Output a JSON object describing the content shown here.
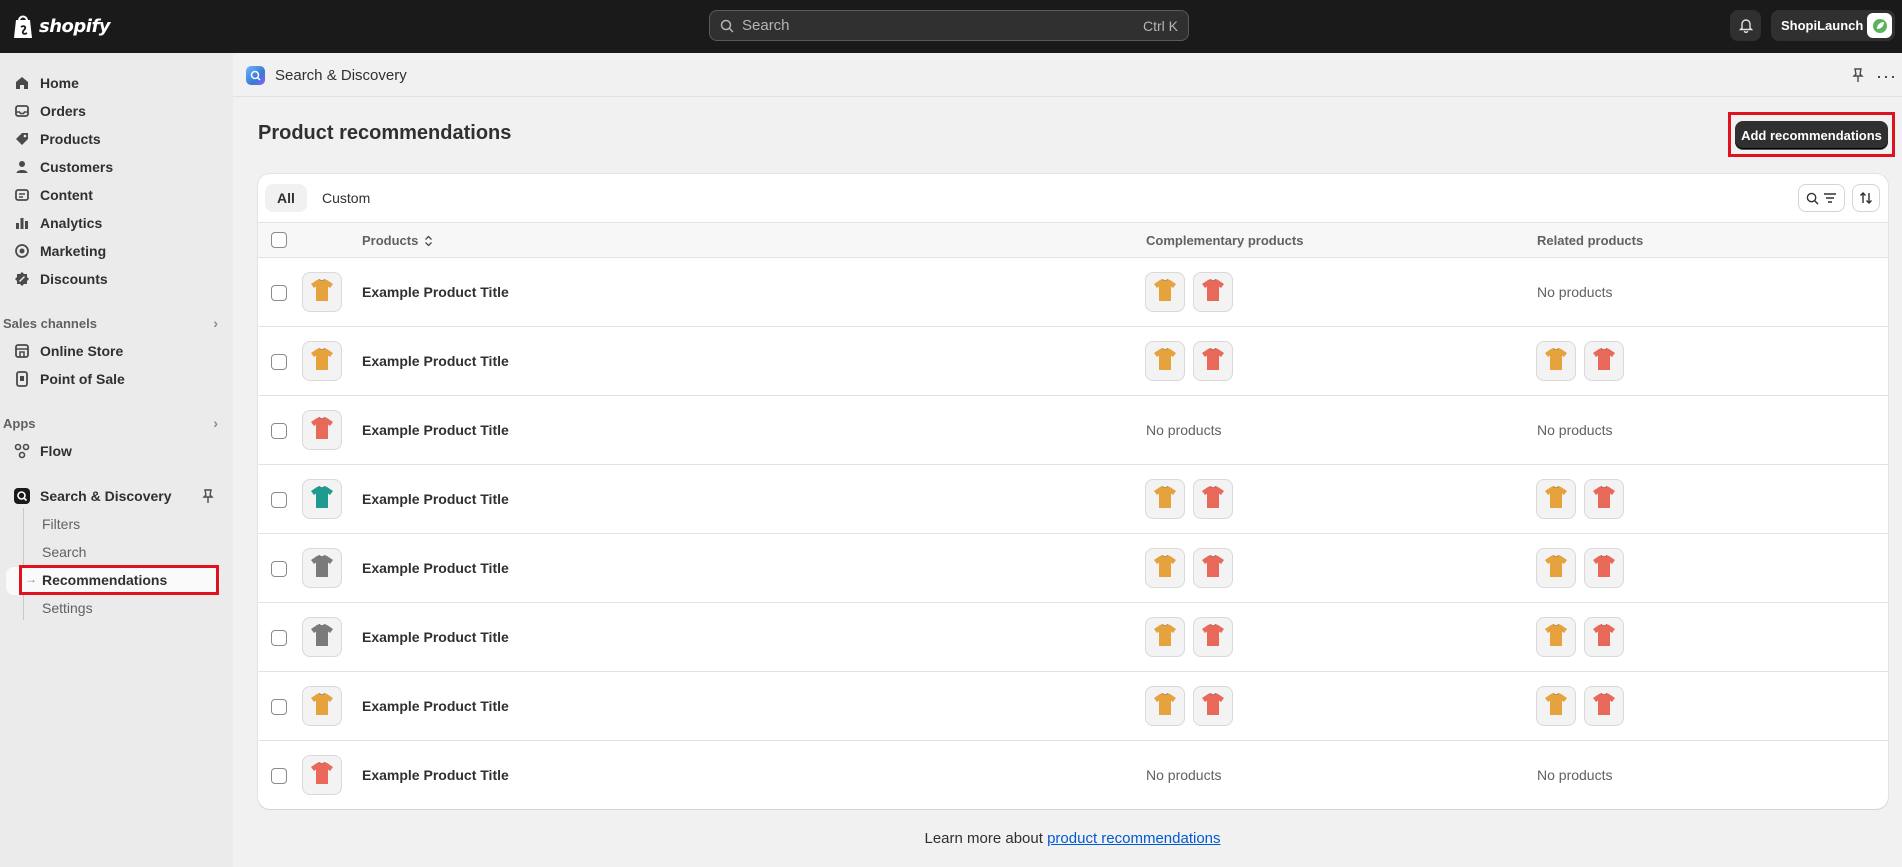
{
  "topbar": {
    "logo_text": "shopify",
    "search_placeholder": "Search",
    "search_shortcut": "Ctrl K",
    "store_name": "ShopiLaunch"
  },
  "sidebar": {
    "main_items": [
      "Home",
      "Orders",
      "Products",
      "Customers",
      "Content",
      "Analytics",
      "Marketing",
      "Discounts"
    ],
    "sales_channels_label": "Sales channels",
    "sales_channels": [
      "Online Store",
      "Point of Sale"
    ],
    "apps_label": "Apps",
    "apps": [
      "Flow"
    ],
    "app_section": "Search & Discovery",
    "app_sub": [
      "Filters",
      "Search",
      "Recommendations",
      "Settings"
    ]
  },
  "header": {
    "breadcrumb": "Search & Discovery",
    "title": "Product recommendations",
    "add_button": "Add recommendations"
  },
  "tabs": [
    "All",
    "Custom"
  ],
  "table": {
    "columns": [
      "Products",
      "Complementary products",
      "Related products"
    ],
    "empty_text": "No products",
    "rows": [
      {
        "name": "Example Product Title",
        "color": "#e6a23c",
        "complementary": [
          "#e6a23c",
          "#e8685a"
        ],
        "related": []
      },
      {
        "name": "Example Product Title",
        "color": "#e6a23c",
        "complementary": [
          "#e6a23c",
          "#e8685a"
        ],
        "related": [
          "#e6a23c",
          "#e8685a"
        ]
      },
      {
        "name": "Example Product Title",
        "color": "#e8685a",
        "complementary": [],
        "related": []
      },
      {
        "name": "Example Product Title",
        "color": "#1f9a8e",
        "complementary": [
          "#e6a23c",
          "#e8685a"
        ],
        "related": [
          "#e6a23c",
          "#e8685a"
        ]
      },
      {
        "name": "Example Product Title",
        "color": "#7a7a7a",
        "complementary": [
          "#e6a23c",
          "#e8685a"
        ],
        "related": [
          "#e6a23c",
          "#e8685a"
        ]
      },
      {
        "name": "Example Product Title",
        "color": "#7a7a7a",
        "complementary": [
          "#e6a23c",
          "#e8685a"
        ],
        "related": [
          "#e6a23c",
          "#e8685a"
        ]
      },
      {
        "name": "Example Product Title",
        "color": "#e6a23c",
        "complementary": [
          "#e6a23c",
          "#e8685a"
        ],
        "related": [
          "#e6a23c",
          "#e8685a"
        ]
      },
      {
        "name": "Example Product Title",
        "color": "#e8685a",
        "complementary": [],
        "related": []
      }
    ]
  },
  "footer": {
    "text": "Learn more about",
    "link": "product recommendations"
  },
  "colors": {
    "topbar": "#1a1a1a",
    "highlight": "#e1121f",
    "link": "#005bd3"
  }
}
